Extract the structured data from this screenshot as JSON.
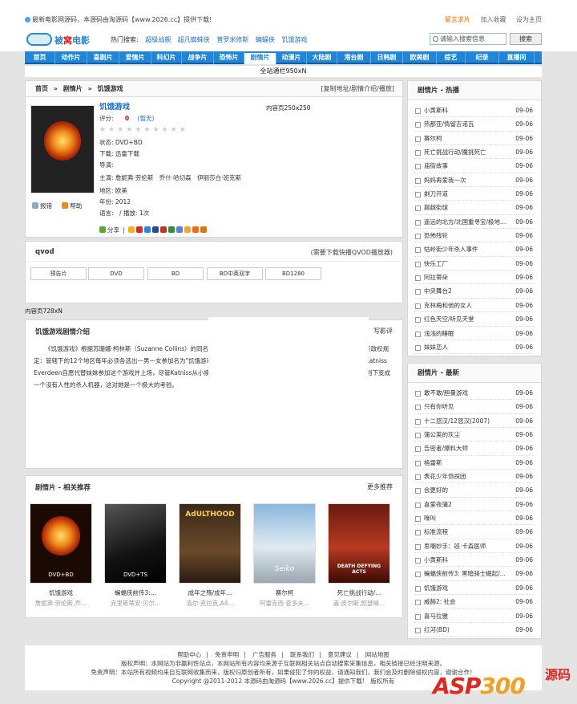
{
  "topbar": {
    "notice": "最新电影网源码，本源码由淘源码【www.2026.cc】提供下载!",
    "links": [
      "留言求片",
      "加入收藏",
      "设为主页"
    ]
  },
  "header": {
    "logo_text": "被窝电影",
    "logo_highlight": "窝",
    "hot_label": "热门搜索:",
    "hot_keywords": [
      "超级战舰",
      "超凡蜘蛛侠",
      "普罗米修斯",
      "蝙蝠侠",
      "饥饿游戏"
    ],
    "search_placeholder": "请输入搜索信息",
    "search_button": "搜索"
  },
  "nav": {
    "items": [
      "首页",
      "动作片",
      "喜剧片",
      "爱情片",
      "科幻片",
      "战争片",
      "恐怖片",
      "剧情片",
      "动漫片",
      "大陆剧",
      "港台剧",
      "日韩剧",
      "欧美剧",
      "综艺",
      "纪录",
      "直播间"
    ],
    "current": 7
  },
  "banner": "全站通栏950xN",
  "detail": {
    "breadcrumb": [
      "首页",
      "»",
      "剧情片",
      "»",
      "饥饿游戏"
    ],
    "actions": "[复制地址/剧情介绍/播放]",
    "title": "饥饿游戏",
    "score_label": "评分:",
    "score_value": "0",
    "score_none": "(暂无)",
    "status": "状态: DVD+BD",
    "download": "下载: 迅雷下载",
    "director": "导演:",
    "actors": "主演: 詹妮弗·劳伦斯　乔什·哈切森　伊丽莎白·班克斯",
    "region": "地区: 欧美",
    "year": "年份: 2012",
    "lang": "语言:　/ 播放: 1次",
    "share_label": "分享",
    "report": "报错",
    "help": "帮助",
    "ad": "内容页250x250",
    "poster_caption": ""
  },
  "player": {
    "name": "qvod",
    "hint": "(需要下载快播QVOD播放器)",
    "tabs": [
      "预告片",
      "DVD",
      "BD",
      "BD中英双字",
      "BD1280"
    ]
  },
  "ad728": "内容页728xN",
  "intro": {
    "title": "饥饿游戏剧情介绍",
    "review_link": "写影评",
    "text": "《饥饿游戏》根据苏珊娜·柯林斯（Suzanne Collins）的同名小说改编，讲述在未来的国度上，人们建立了新的家园，但新政权规定：管辖下的12个地区每年必须各选出一男一女参加名为\"饥饿游戏\"的电视直播节目，节目的规则很简单——杀人或者被杀。Katniss Everdeen自愿代替妹妹参加这个游戏并上场，尽管Katniss从小摸爬滚打惯了，对节目里的重重阻碍都能应付自如，但要在规则下变成一个没有人性的杀人机器，这对她是一个极大的考验。"
  },
  "related": {
    "title": "剧情片 - 相关推荐",
    "more": "更多推荐",
    "items": [
      {
        "title": "饥饿游戏",
        "actors": "詹妮弗·劳伦斯,乔...",
        "badge": "DVD+BD"
      },
      {
        "title": "蝙蝠侠前传3:...",
        "actors": "克里斯蒂安·贝尔...",
        "badge": "DVD+TS"
      },
      {
        "title": "成年之殇/成年...",
        "actors": "洛尔·克拉克,A4...",
        "badge": "AdULTHOOD"
      },
      {
        "title": "赛尔柯",
        "actors": "阿雷克西·查多夫...",
        "badge": "Seiko"
      },
      {
        "title": "死亡挑战行动/...",
        "actors": "盖·皮尔斯,凯瑟琳...",
        "badge": "DEATH DEFYING ACTS"
      }
    ]
  },
  "hot_list": {
    "title": "剧情片 - 热播",
    "items": [
      {
        "name": "小黄斯科",
        "date": "09-06"
      },
      {
        "name": "热那亚/情留吉诺瓦",
        "date": "09-06"
      },
      {
        "name": "赛尔柯",
        "date": "09-06"
      },
      {
        "name": "死亡挑战行动/魔挑死亡",
        "date": "09-06"
      },
      {
        "name": "庙街故事",
        "date": "09-06"
      },
      {
        "name": "妈妈再爱我一次",
        "date": "09-06"
      },
      {
        "name": "剃刀开道",
        "date": "09-06"
      },
      {
        "name": "巅越街球",
        "date": "09-06"
      },
      {
        "name": "遥远的北方/北国重寻宝/极地...",
        "date": "09-06"
      },
      {
        "name": "恐怖残轮",
        "date": "09-06"
      },
      {
        "name": "牯岭街少年杀人事件",
        "date": "09-06"
      },
      {
        "name": "快乐工厂",
        "date": "09-06"
      },
      {
        "name": "阿拉蒂朵",
        "date": "09-06"
      },
      {
        "name": "中央舞台2",
        "date": "09-06"
      },
      {
        "name": "克林梅和他的女人",
        "date": "09-06"
      },
      {
        "name": "红色天空/听见天堂",
        "date": "09-06"
      },
      {
        "name": "浅浅的睡眠",
        "date": "09-06"
      },
      {
        "name": "妹妹恋人",
        "date": "09-06"
      }
    ]
  },
  "new_list": {
    "title": "剧情片 - 最新",
    "items": [
      {
        "name": "敢不敢/胆量游戏",
        "date": "09-06"
      },
      {
        "name": "只有你听见",
        "date": "09-06"
      },
      {
        "name": "十二怒汉/12怒汉(2007)",
        "date": "09-06"
      },
      {
        "name": "蒲公英的灰尘",
        "date": "09-06"
      },
      {
        "name": "告密者/爆料大师",
        "date": "09-06"
      },
      {
        "name": "格雷斯",
        "date": "09-06"
      },
      {
        "name": "表花少年饰探团",
        "date": "09-06"
      },
      {
        "name": "会更好的",
        "date": "09-06"
      },
      {
        "name": "喜爱夜蒲2",
        "date": "09-06"
      },
      {
        "name": "嚎叫",
        "date": "09-06"
      },
      {
        "name": "标准流程",
        "date": "09-06"
      },
      {
        "name": "思嘲妙手：班·卡森医师",
        "date": "09-06"
      },
      {
        "name": "小黄斯科",
        "date": "09-06"
      },
      {
        "name": "蝙蝠侠前传3: 黑暗骑士崛起/...",
        "date": "09-06"
      },
      {
        "name": "饥饿游戏",
        "date": "09-06"
      },
      {
        "name": "威赫2: 社会",
        "date": "09-06"
      },
      {
        "name": "喜马拉雅",
        "date": "09-06"
      },
      {
        "name": "红河(BD)",
        "date": "09-06"
      }
    ]
  },
  "footer": {
    "links": [
      "帮助中心",
      "免责申明",
      "广告服务",
      "联系我们",
      "意见建议",
      "网站地图"
    ],
    "line1": "版权声明：本网站为非赢利性站点，本网站所有内容均来源于互联网相关站点自动搜索采集信息，相关链接已经注明来源。",
    "line2": "免责声明：本站所有视频均来自互联网收集而来，版权归原创者所有，如果侵犯了你的权益，请通知我们，我们会及时删除侵权内容，谢谢合作！",
    "copyright": "Copyright @2011-2012 本源码由淘源码【www.2026.cc】提供下载!　版权所有"
  },
  "watermark": {
    "text": "ASP300",
    "cn": "源码"
  }
}
